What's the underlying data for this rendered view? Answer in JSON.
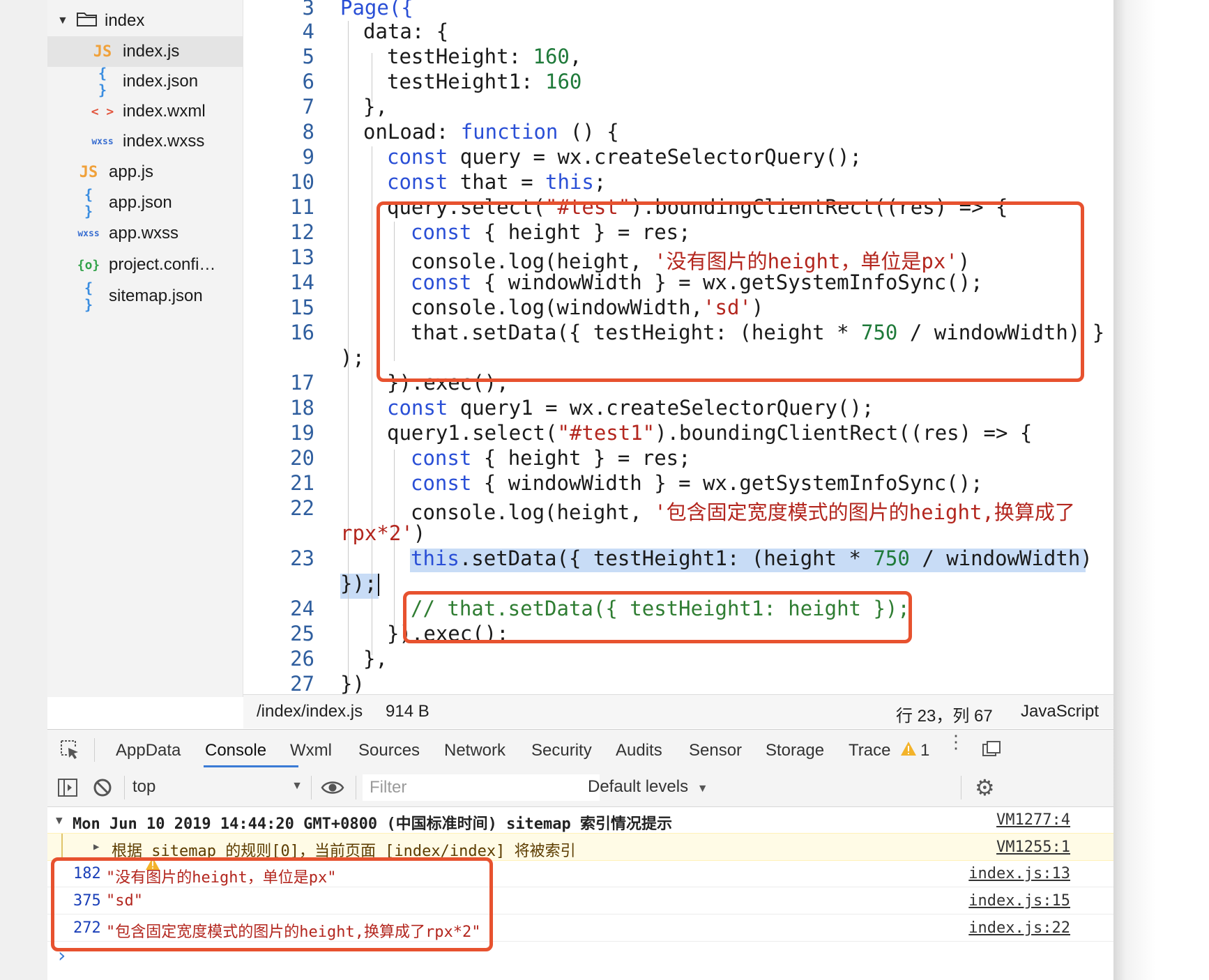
{
  "sidebar": {
    "items": [
      {
        "label": "index",
        "icon": "folder-icon"
      },
      {
        "label": "index.js",
        "icon": "js-file-icon",
        "badge": "JS"
      },
      {
        "label": "index.json",
        "icon": "json-file-icon",
        "badge": "{ }"
      },
      {
        "label": "index.wxml",
        "icon": "wxml-file-icon",
        "badge": "< >"
      },
      {
        "label": "index.wxss",
        "icon": "wxss-file-icon",
        "badge": "wxss"
      },
      {
        "label": "app.js",
        "icon": "js-file-icon",
        "badge": "JS"
      },
      {
        "label": "app.json",
        "icon": "json-file-icon",
        "badge": "{ }"
      },
      {
        "label": "app.wxss",
        "icon": "wxss-file-icon",
        "badge": "wxss"
      },
      {
        "label": "project.confi…",
        "icon": "config-file-icon",
        "badge": "{o}"
      },
      {
        "label": "sitemap.json",
        "icon": "json-file-icon",
        "badge": "{ }"
      }
    ]
  },
  "editor": {
    "line_numbers": [
      "3",
      "4",
      "5",
      "6",
      "7",
      "8",
      "9",
      "10",
      "11",
      "12",
      "13",
      "14",
      "15",
      "16",
      "17",
      "18",
      "19",
      "20",
      "21",
      "22",
      "23",
      "24",
      "25",
      "26",
      "27"
    ],
    "code": {
      "l3": "Page({",
      "l4": "data: {",
      "l5_key": "testHeight: ",
      "l5_val": "160",
      "l5_end": ",",
      "l6_key": "testHeight1: ",
      "l6_val": "160",
      "l7": "},",
      "l8_key": "onLoad: ",
      "l8_kw": "function",
      "l8_end": " () {",
      "l9_kw": "const",
      "l9_rest": " query = wx.createSelectorQuery();",
      "l10_kw": "const",
      "l10_mid": " that = ",
      "l10_kw2": "this",
      "l10_end": ";",
      "l11_a": "query.select(",
      "l11_str": "\"#test\"",
      "l11_b": ").boundingClientRect((res) => {",
      "l12_kw": "const",
      "l12_rest": " { height } = res;",
      "l13_a": "console.log(height, ",
      "l13_str": "'没有图片的height，单位是px'",
      "l13_b": ")",
      "l14_kw": "const",
      "l14_rest": " { windowWidth } = wx.getSystemInfoSync();",
      "l15_a": "console.log(windowWidth,",
      "l15_str": "'sd'",
      "l15_b": ")",
      "l16_a": "that.setData({ testHeight: (height * ",
      "l16_num": "750",
      "l16_b": " / windowWidth) }",
      "l16_wrap": ");",
      "l17": "}).exec();",
      "l18_kw": "const",
      "l18_rest": " query1 = wx.createSelectorQuery();",
      "l19_a": "query1.select(",
      "l19_str": "\"#test1\"",
      "l19_b": ").boundingClientRect((res) => {",
      "l20_kw": "const",
      "l20_rest": " { height } = res;",
      "l21_kw": "const",
      "l21_rest": " { windowWidth } = wx.getSystemInfoSync();",
      "l22_a": "console.log(height, ",
      "l22_str": "'包含固定宽度模式的图片的height,换算成了",
      "l22_wrap_str": "rpx*2'",
      "l22_wrap_end": ")",
      "l23_kw": "this",
      "l23_a": ".setData({ testHeight1: (height * ",
      "l23_num": "750",
      "l23_b": " / windowWidth)",
      "l23_wrap": "});",
      "l24": "// that.setData({ testHeight1: height });",
      "l25": "}).exec();",
      "l26": "},",
      "l27": "})"
    }
  },
  "statusbar": {
    "path": "/index/index.js",
    "size": "914 B",
    "position": "行 23，列 67",
    "language": "JavaScript"
  },
  "devtools": {
    "tabs": [
      "AppData",
      "Console",
      "Wxml",
      "Sources",
      "Network",
      "Security",
      "Audits",
      "Sensor",
      "Storage",
      "Trace"
    ],
    "active_tab": "Console",
    "warning_count": "1",
    "context": "top",
    "filter_placeholder": "Filter",
    "levels": "Default levels"
  },
  "console": {
    "group_header": "Mon Jun 10 2019 14:44:20 GMT+0800 (中国标准时间) sitemap 索引情况提示",
    "group_source": "VM1277:4",
    "warning_text": "根据 sitemap 的规则[0]，当前页面 [index/index] 将被索引",
    "warning_source": "VM1255:1",
    "logs": [
      {
        "num": "182",
        "text": "\"没有图片的height，单位是px\"",
        "source": "index.js:13"
      },
      {
        "num": "375",
        "text": "\"sd\"",
        "source": "index.js:15"
      },
      {
        "num": "272",
        "text": "\"包含固定宽度模式的图片的height,换算成了rpx*2\"",
        "source": "index.js:22"
      }
    ],
    "prompt": "›"
  },
  "colors": {
    "annotation_red": "#e7522f",
    "keyword_blue": "#2a4fd6",
    "string_red": "#b3261e",
    "number_green": "#1f7a3a",
    "selection_blue": "#c8dcf6"
  }
}
